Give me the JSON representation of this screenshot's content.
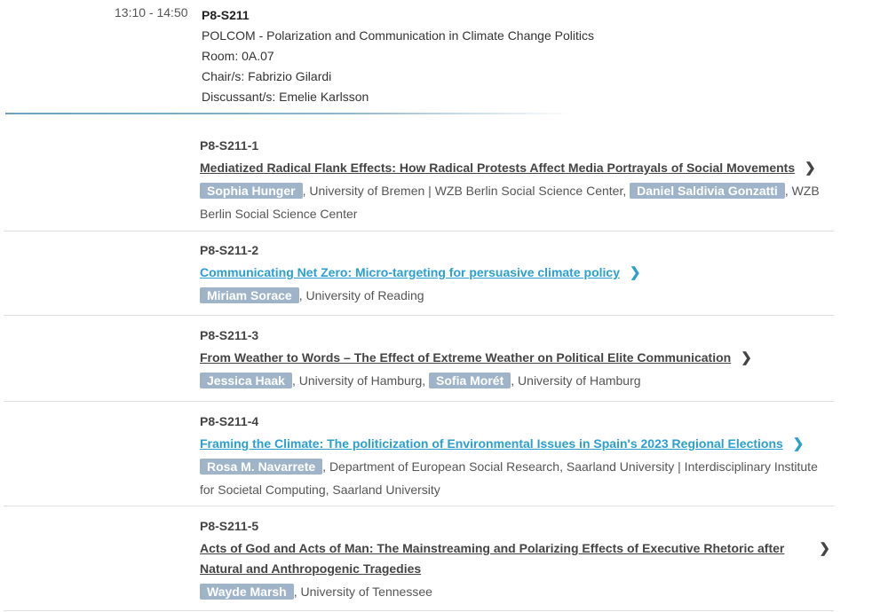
{
  "session": {
    "time": "13:10 - 14:50",
    "code": "P8-S211",
    "title": "POLCOM - Polarization and Communication in Climate Change Politics",
    "room": "Room: 0A.07",
    "chair": "Chair/s: Fabrizio Gilardi",
    "discussant": "Discussant/s: Emelie Karlsson"
  },
  "chevron_glyph": "❯",
  "papers": [
    {
      "code": "P8-S211-1",
      "title": "Mediatized Radical Flank Effects: How Radical Protests Affect Media Portrayals of Social Movements",
      "authors": [
        {
          "name": "Sophia Hunger",
          "affiliation": ", University of Bremen | WZB Berlin Social Science Center, "
        },
        {
          "name": "Daniel Saldivia Gonzatti",
          "affiliation": ", WZB Berlin Social Science Center"
        }
      ]
    },
    {
      "code": "P8-S211-2",
      "title": "Communicating Net Zero: Micro-targeting for persuasive climate policy",
      "authors": [
        {
          "name": "Miriam Sorace",
          "affiliation": ", University of Reading"
        }
      ]
    },
    {
      "code": "P8-S211-3",
      "title": "From Weather to Words – The Effect of Extreme Weather on Political Elite Communication",
      "authors": [
        {
          "name": "Jessica Haak",
          "affiliation": ", University of Hamburg, "
        },
        {
          "name": "Sofia Morét",
          "affiliation": ", University of Hamburg"
        }
      ]
    },
    {
      "code": "P8-S211-4",
      "title": "Framing the Climate: The politicization of Environmental Issues in Spain's 2023 Regional Elections",
      "authors": [
        {
          "name": "Rosa M. Navarrete",
          "affiliation": ", Department of European Social Research, Saarland University | Interdisciplinary Institute for Societal Computing, Saarland University"
        }
      ]
    },
    {
      "code": "P8-S211-5",
      "title": "Acts of God and Acts of Man: The Mainstreaming and Polarizing Effects of Executive Rhetoric after Natural and Anthropogenic Tragedies",
      "authors": [
        {
          "name": "Wayde Marsh",
          "affiliation": ", University of Tennessee"
        }
      ]
    }
  ]
}
